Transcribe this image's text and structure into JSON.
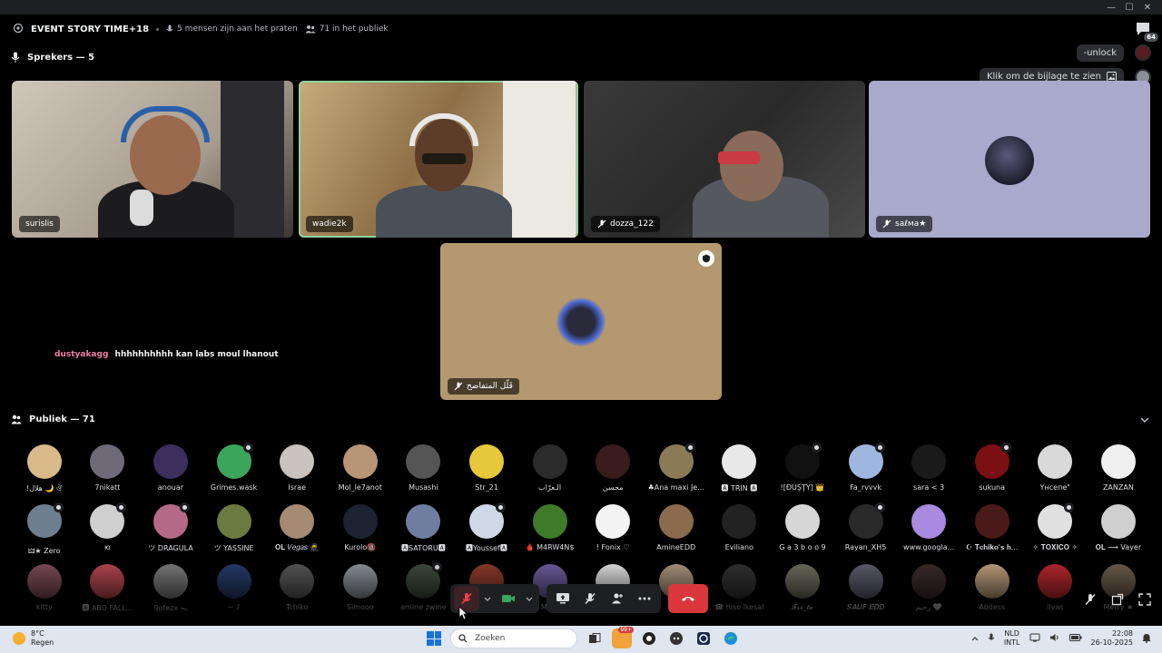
{
  "window": {
    "minimize": "—",
    "maximize": "☐",
    "close": "✕"
  },
  "stage": {
    "title": "EVENT STORY TIME+18",
    "talking": "5 mensen zijn aan het praten",
    "audience_count": "71 in het publiek"
  },
  "notifications": {
    "count": "64"
  },
  "speakers_label": "Sprekers — 5",
  "pills": {
    "unlock": "-unlock",
    "attachment": "Klik om de bijlage te zien"
  },
  "speakers": [
    {
      "name": "surislis",
      "muted": false,
      "speaking": false
    },
    {
      "name": "wadie2k",
      "muted": false,
      "speaking": true
    },
    {
      "name": "dozza_122",
      "muted": true,
      "speaking": false
    },
    {
      "name": "saℓмa★",
      "muted": true,
      "speaking": false
    },
    {
      "name": "قَلّل المتفاضح",
      "muted": true,
      "speaking": false
    }
  ],
  "chat": {
    "user": "dustyakagg",
    "text": "hhhhhhhhhh kan labs moul lhanout"
  },
  "audience_label": "Publiek — 71",
  "audience": [
    {
      "name": "!هلال 🌙 ঔ",
      "color": "#d9b98a",
      "mod": false
    },
    {
      "name": "7nikatt",
      "color": "#6e6a78",
      "mod": false
    },
    {
      "name": "anouar",
      "color": "#3c2f5e",
      "mod": false
    },
    {
      "name": "Grimes.wask",
      "color": "#3ba55c",
      "mod": true
    },
    {
      "name": "Israe",
      "color": "#c9c2bd",
      "mod": false
    },
    {
      "name": "Mol_le7anot",
      "color": "#b89576",
      "mod": false
    },
    {
      "name": "Musashi",
      "color": "#555555",
      "mod": false
    },
    {
      "name": "Str_21",
      "color": "#e6c83a",
      "mod": false
    },
    {
      "name": "الـعرّاب",
      "color": "#2b2b2b",
      "mod": false
    },
    {
      "name": "محسن",
      "color": "#3a1c1c",
      "mod": false
    },
    {
      "name": "♣Ana maxi Je...",
      "color": "#8a7a56",
      "mod": true
    },
    {
      "name": "🅰 TRIN 🅰",
      "color": "#e8e8e8",
      "mod": false
    },
    {
      "name": "![ĐŪŞŢŶ] 👑",
      "color": "#111111",
      "mod": true
    },
    {
      "name": "Fa_rvvvk",
      "color": "#9fb7de",
      "mod": true
    },
    {
      "name": "sara < 3",
      "color": "#1a1a1a",
      "mod": false
    },
    {
      "name": "sukuna",
      "color": "#7a0f14",
      "mod": true
    },
    {
      "name": "Үнсепе\"",
      "color": "#d9d9d9",
      "mod": false
    },
    {
      "name": "ZANZAN",
      "color": "#f0f0f0",
      "mod": false
    },
    {
      "name": "🜲★ Zero",
      "color": "#6d7f8f",
      "mod": true
    },
    {
      "name": "ю",
      "color": "#cfcfcf",
      "mod": true
    },
    {
      "name": "ツ DRAGULA",
      "color": "#b46a86",
      "mod": true
    },
    {
      "name": "ツ YASSINE",
      "color": "#6b7a3e",
      "mod": false
    },
    {
      "name": "𝐎𝐋 𝑉𝑒𝑔𝑎𝑠 🥷",
      "color": "#a58a74",
      "mod": false
    },
    {
      "name": "Kurolo🔞",
      "color": "#1d2330",
      "mod": false
    },
    {
      "name": "🅰SATORU🅰",
      "color": "#6f7ea0",
      "mod": false
    },
    {
      "name": "🅰Youssef🅰",
      "color": "#cfd8e6",
      "mod": true
    },
    {
      "name": "🩸 M4RW4N$",
      "color": "#3e7a2a",
      "mod": false
    },
    {
      "name": "! Fonix ♡",
      "color": "#f4f4f4",
      "mod": false
    },
    {
      "name": "AmineEDD",
      "color": "#8b6a4e",
      "mod": false
    },
    {
      "name": "Eviliano",
      "color": "#222222",
      "mod": false
    },
    {
      "name": "G a 3 b o o 9",
      "color": "#d6d6d6",
      "mod": false
    },
    {
      "name": "Rayan_XH5",
      "color": "#2a2a2a",
      "mod": true
    },
    {
      "name": "www.googla...",
      "color": "#a88be0",
      "mod": false
    },
    {
      "name": "☪ 𝐓𝐜𝐡𝐢𝐤𝐨'𝐬 𝐡...",
      "color": "#4a1a1a",
      "mod": false
    },
    {
      "name": "✧ 𝐓𝐎𝐗𝐈𝐂𝐎 ✧",
      "color": "#e0e0e0",
      "mod": true
    },
    {
      "name": "𝐎𝐋 ⟶ Vayer",
      "color": "#cfcfcf",
      "mod": false
    },
    {
      "name": "kitty",
      "color": "#7a4a55",
      "mod": false
    },
    {
      "name": "🅰 ABO FALL...",
      "color": "#b3454f",
      "mod": false
    },
    {
      "name": "9ofezx ᯓ",
      "color": "#777777",
      "mod": false
    },
    {
      "name": "~ ♪",
      "color": "#243a66",
      "mod": false
    },
    {
      "name": "Tchiko",
      "color": "#555555",
      "mod": false
    },
    {
      "name": "Simooo",
      "color": "#8a8f96",
      "mod": false
    },
    {
      "name": "amine zwine",
      "color": "#3a4a3a",
      "mod": true
    },
    {
      "name": "Chang ⚡",
      "color": "#8a3a2a",
      "mod": false
    },
    {
      "name": "Mo...",
      "color": "#6a5a9a",
      "mod": false
    },
    {
      "name": "...",
      "color": "#dcdcdc",
      "mod": false
    },
    {
      "name": "...",
      "color": "#a69078",
      "mod": false
    },
    {
      "name": "☎ hiso lkesal",
      "color": "#303030",
      "mod": false
    },
    {
      "name": "𝓕𝓻𝓲_𝓽𝓪",
      "color": "#6a6a5a",
      "mod": false
    },
    {
      "name": "𝑺𝑨𝑼𝑭 𝑬𝑫𝑫",
      "color": "#5a5a6a",
      "mod": false
    },
    {
      "name": "رحيم 🤍",
      "color": "#3a2a2a",
      "mod": false
    },
    {
      "name": "Abdess",
      "color": "#b89a7a",
      "mod": false
    },
    {
      "name": "ilyas",
      "color": "#b3262c",
      "mod": false
    },
    {
      "name": "Merry ★",
      "color": "#6a5a4a",
      "mod": false
    }
  ],
  "taskbar": {
    "temp": "8°C",
    "weather": "Regen",
    "search": "Zoeken",
    "app_badge": "99+",
    "lang1": "NLD",
    "lang2": "INTL",
    "time": "22:08",
    "date": "26-10-2025"
  },
  "colors": {
    "accent": "#8fd19e",
    "end_call": "#da373c",
    "mention": "#f27ea8"
  }
}
